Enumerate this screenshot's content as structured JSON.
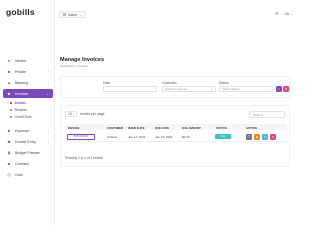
{
  "app": {
    "logo": "gobills"
  },
  "topbar": {
    "business_label": "Natus",
    "user_label": "Ulv"
  },
  "sidebar": {
    "items": [
      {
        "label": "Vendor",
        "icon": "person-icon"
      },
      {
        "label": "Private",
        "icon": "lock-icon"
      },
      {
        "label": "Banking",
        "icon": "bank-icon"
      },
      {
        "label": "Invoices",
        "icon": "invoice-icon"
      },
      {
        "label": "Expense",
        "icon": "expense-icon"
      },
      {
        "label": "Double Entry",
        "icon": "ledger-icon"
      },
      {
        "label": "Budget Planner",
        "icon": "chart-icon"
      },
      {
        "label": "Contract",
        "icon": "contract-icon"
      },
      {
        "label": "Goal",
        "icon": "target-icon"
      }
    ],
    "invoice_subitems": [
      "Invoice",
      "Retainer",
      "Credit Note"
    ]
  },
  "page": {
    "title": "Manage Invoices",
    "breadcrumb": "Dashboard  >  Invoice"
  },
  "filters": {
    "date_label": "Date",
    "customer_label": "Customer",
    "customer_placeholder": "Select Customer",
    "status_label": "Status",
    "status_placeholder": "Select Status",
    "colors": {
      "search_button": "#7c4ab8",
      "reset_button": "#e0428b"
    }
  },
  "table": {
    "per_page": "10",
    "per_page_suffix": "entries per page",
    "search_placeholder": "Search...",
    "headers": [
      "INVOICE",
      "CUSTOMER",
      "ISSUE DATE",
      "DUE DATE",
      "DUE AMOUNT",
      "STATUS",
      "ACTION"
    ],
    "rows": [
      {
        "invoice": "#INVO00001",
        "customer": "Andrew",
        "issue_date": "Jan 17, 2023",
        "due_date": "Jan 13, 2023",
        "due_amount": "$0.00",
        "status": "Paid"
      }
    ],
    "footer": "Showing 1 to 1 of 1 entries",
    "action_colors": [
      "#6c757d",
      "#fd7e14",
      "#3ec1c9",
      "#e0428b"
    ]
  },
  "colors": {
    "accent": "#7c4ab8",
    "status_paid": "#3ec1c9"
  }
}
